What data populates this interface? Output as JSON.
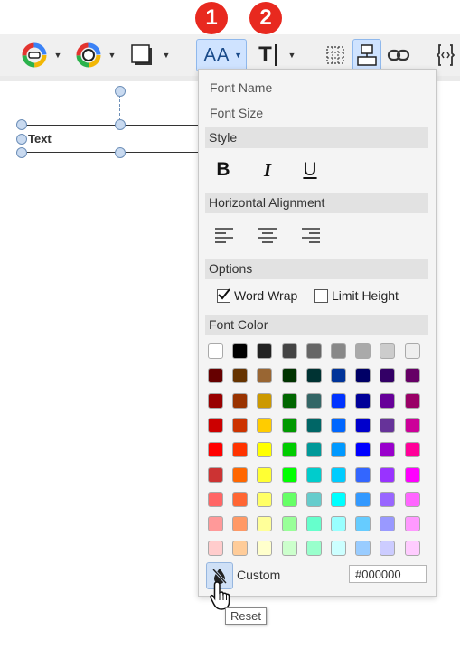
{
  "annotations": {
    "badge1": "1",
    "badge2": "2"
  },
  "toolbar": {
    "items": [
      "fill-color",
      "line-color",
      "shadow",
      "text-size",
      "text-tools",
      "grid",
      "layout",
      "link",
      "embed"
    ],
    "active": "text-size",
    "text_size_glyph": "AA",
    "text_tool_glyph": "T"
  },
  "canvas": {
    "shape_label": "Text"
  },
  "popup": {
    "font_name": "Font Name",
    "font_size": "Font Size",
    "style_header": "Style",
    "bold": "B",
    "italic": "I",
    "underline": "U",
    "align_header": "Horizontal Alignment",
    "options_header": "Options",
    "word_wrap_label": "Word Wrap",
    "word_wrap_checked": true,
    "limit_height_label": "Limit Height",
    "limit_height_checked": false,
    "font_color_header": "Font Color",
    "swatches": [
      [
        "#ffffff",
        "#000000",
        "#222222",
        "#444444",
        "#666666",
        "#888888",
        "#aaaaaa",
        "#cccccc",
        "#eeeeee"
      ],
      [
        "#660000",
        "#663300",
        "#996633",
        "#003300",
        "#003333",
        "#003399",
        "#000066",
        "#330066",
        "#660066"
      ],
      [
        "#990000",
        "#993300",
        "#cc9900",
        "#006600",
        "#336666",
        "#0033ff",
        "#000099",
        "#660099",
        "#990066"
      ],
      [
        "#cc0000",
        "#cc3300",
        "#ffcc00",
        "#009900",
        "#006666",
        "#0066ff",
        "#0000cc",
        "#663399",
        "#cc0099"
      ],
      [
        "#ff0000",
        "#ff3300",
        "#ffff00",
        "#00cc00",
        "#009999",
        "#0099ff",
        "#0000ff",
        "#9900cc",
        "#ff0099"
      ],
      [
        "#cc3333",
        "#ff6600",
        "#ffff33",
        "#00ff00",
        "#00cccc",
        "#00ccff",
        "#3366ff",
        "#9933ff",
        "#ff00ff"
      ],
      [
        "#ff6666",
        "#ff6633",
        "#ffff66",
        "#66ff66",
        "#66cccc",
        "#00ffff",
        "#3399ff",
        "#9966ff",
        "#ff66ff"
      ],
      [
        "#ff9999",
        "#ff9966",
        "#ffff99",
        "#99ff99",
        "#66ffcc",
        "#99ffff",
        "#66ccff",
        "#9999ff",
        "#ff99ff"
      ],
      [
        "#ffcccc",
        "#ffcc99",
        "#ffffcc",
        "#ccffcc",
        "#99ffcc",
        "#ccffff",
        "#99ccff",
        "#ccccff",
        "#ffccff"
      ]
    ],
    "custom_label": "Custom",
    "custom_value": "#000000",
    "reset_tooltip": "Reset"
  }
}
